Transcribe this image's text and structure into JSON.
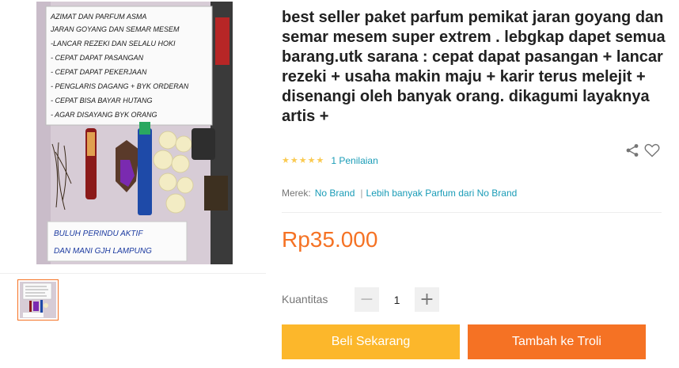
{
  "product": {
    "title": "best seller paket parfum pemikat jaran goyang dan semar mesem super extrem . lebgkap dapet semua barang.utk sarana : cepat dapat pasangan + lancar rezeki + usaha makin maju + karir terus melejit + disenangi oleh banyak orang. dikagumi layaknya artis +",
    "rating_stars": 5,
    "rating_count_label": "1 Penilaian",
    "brand_label": "Merek:",
    "brand_value": "No Brand",
    "brand_separator": "|",
    "more_from_brand": "Lebih banyak Parfum dari No Brand",
    "price": "Rp35.000"
  },
  "quantity": {
    "label": "Kuantitas",
    "value": "1"
  },
  "actions": {
    "buy_now": "Beli Sekarang",
    "add_to_cart": "Tambah ke Troli"
  },
  "photo_text": {
    "lines": [
      "AZIMAT DAN PARFUM ASMA",
      "JARAN GOYANG DAN SEMAR MESEM",
      "-LANCAR REZEKI DAN SELALU HOKI",
      "- CEPAT DAPAT PASANGAN",
      "- CEPAT DAPAT PEKERJAAN",
      "- PENGLARIS DAGANG + BYK ORDERAN",
      "- CEPAT BISA BAYAR HUTANG",
      "- AGAR DISAYANG BYK ORANG"
    ],
    "bottom": [
      "BULUH PERINDU AKTIF",
      "DAN MANI GJH LAMPUNG"
    ]
  },
  "colors": {
    "accent_orange": "#f57224",
    "button_yellow": "#fcb72b",
    "link_blue": "#1a9cb7",
    "star_yellow": "#faca51"
  },
  "icons": {
    "share": "share-icon",
    "wishlist": "heart-icon",
    "minus": "minus-icon",
    "plus": "plus-icon",
    "star": "star-icon"
  }
}
